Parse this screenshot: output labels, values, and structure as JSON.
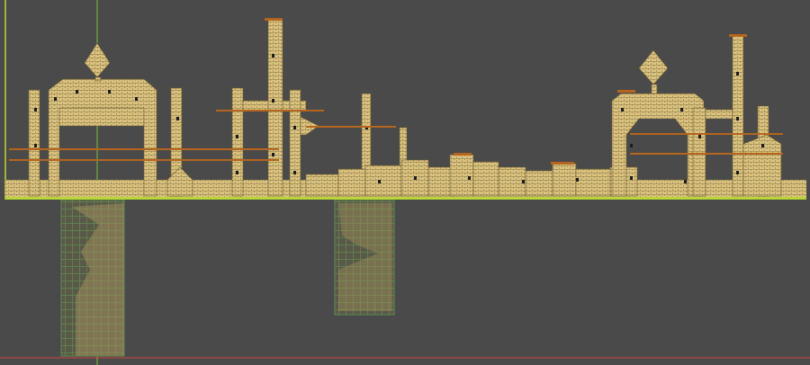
{
  "scene": {
    "kind": "tile-map-level-editor",
    "theme": "desert-temple",
    "colors": {
      "background": "#4a4a4a",
      "brick_light": "#e6d08e",
      "brick_mid": "#c9b06a",
      "brick_dark": "#8a7a46",
      "brick_line": "#6b5b30",
      "hole": "#1c1c1c",
      "ledge_orange": "#b5651d",
      "ground_line": "#b8d63a",
      "axis_green": "#76c43a",
      "axis_red": "#d04040",
      "underground_tint": "#3e5a3a",
      "underground_line": "#5f8a4e",
      "underground_fill": "#6e6a55"
    }
  },
  "legend_hint": {
    "structures": [
      "left-arch-gate",
      "tall-pillar",
      "stepped-ruins",
      "right-arch-gate",
      "far-right-tower"
    ],
    "underground_shafts": 2
  }
}
